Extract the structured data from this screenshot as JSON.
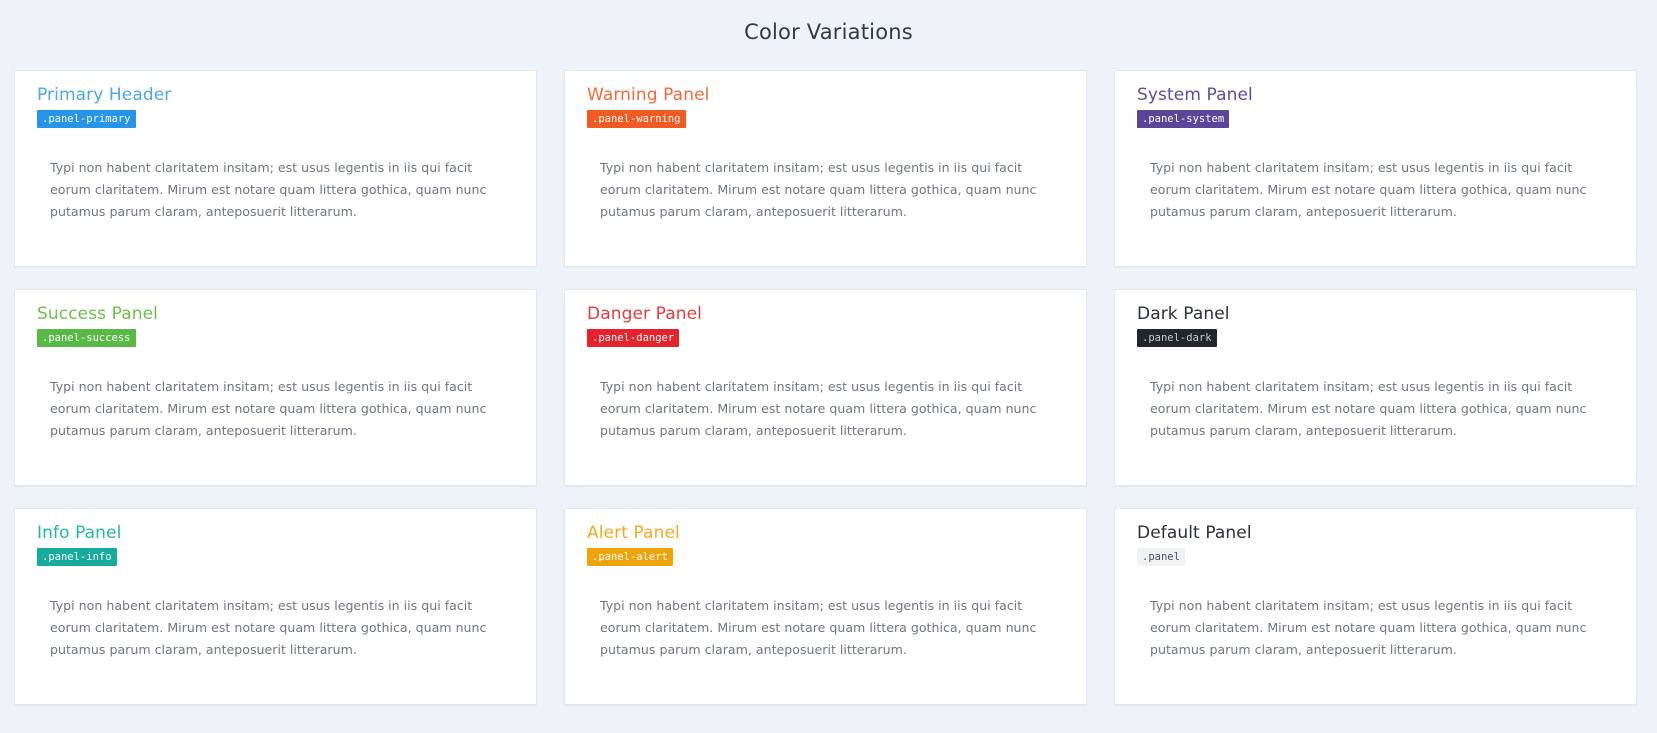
{
  "page": {
    "title": "Color Variations"
  },
  "panels": [
    {
      "title": "Primary Header",
      "code": ".panel-primary",
      "title_color": "#4ba7e8",
      "code_bg": "#2694e8",
      "code_fg": "#ffffff",
      "body": "Typi non habent claritatem insitam; est usus legentis in iis qui facit eorum claritatem. Mirum est notare quam littera gothica, quam nunc putamus parum claram, anteposuerit litterarum."
    },
    {
      "title": "Warning Panel",
      "code": ".panel-warning",
      "title_color": "#f26a36",
      "code_bg": "#f15a22",
      "code_fg": "#ffffff",
      "body": "Typi non habent claritatem insitam; est usus legentis in iis qui facit eorum claritatem. Mirum est notare quam littera gothica, quam nunc putamus parum claram, anteposuerit litterarum."
    },
    {
      "title": "System Panel",
      "code": ".panel-system",
      "title_color": "#5c4aa4",
      "code_bg": "#5a4697",
      "code_fg": "#ffffff",
      "body": "Typi non habent claritatem insitam; est usus legentis in iis qui facit eorum claritatem. Mirum est notare quam littera gothica, quam nunc putamus parum claram, anteposuerit litterarum."
    },
    {
      "title": "Success Panel",
      "code": ".panel-success",
      "title_color": "#6cc04a",
      "code_bg": "#58b947",
      "code_fg": "#ffffff",
      "body": "Typi non habent claritatem insitam; est usus legentis in iis qui facit eorum claritatem. Mirum est notare quam littera gothica, quam nunc putamus parum claram, anteposuerit litterarum."
    },
    {
      "title": "Danger Panel",
      "code": ".panel-danger",
      "title_color": "#e63b3b",
      "code_bg": "#e8222d",
      "code_fg": "#ffffff",
      "body": "Typi non habent claritatem insitam; est usus legentis in iis qui facit eorum claritatem. Mirum est notare quam littera gothica, quam nunc putamus parum claram, anteposuerit litterarum."
    },
    {
      "title": "Dark Panel",
      "code": ".panel-dark",
      "title_color": "#2b2f38",
      "code_bg": "#22252c",
      "code_fg": "#c9ccd2",
      "body": "Typi non habent claritatem insitam; est usus legentis in iis qui facit eorum claritatem. Mirum est notare quam littera gothica, quam nunc putamus parum claram, anteposuerit litterarum."
    },
    {
      "title": "Info Panel",
      "code": ".panel-info",
      "title_color": "#22b8a8",
      "code_bg": "#16ab9c",
      "code_fg": "#ffffff",
      "body": "Typi non habent claritatem insitam; est usus legentis in iis qui facit eorum claritatem. Mirum est notare quam littera gothica, quam nunc putamus parum claram, anteposuerit litterarum."
    },
    {
      "title": "Alert Panel",
      "code": ".panel-alert",
      "title_color": "#f3a91f",
      "code_bg": "#f0a40c",
      "code_fg": "#ffffff",
      "body": "Typi non habent claritatem insitam; est usus legentis in iis qui facit eorum claritatem. Mirum est notare quam littera gothica, quam nunc putamus parum claram, anteposuerit litterarum."
    },
    {
      "title": "Default Panel",
      "code": ".panel",
      "title_color": "#2b2f38",
      "code_bg": "#f0f1f3",
      "code_fg": "#4c5159",
      "body": "Typi non habent claritatem insitam; est usus legentis in iis qui facit eorum claritatem. Mirum est notare quam littera gothica, quam nunc putamus parum claram, anteposuerit litterarum."
    }
  ]
}
